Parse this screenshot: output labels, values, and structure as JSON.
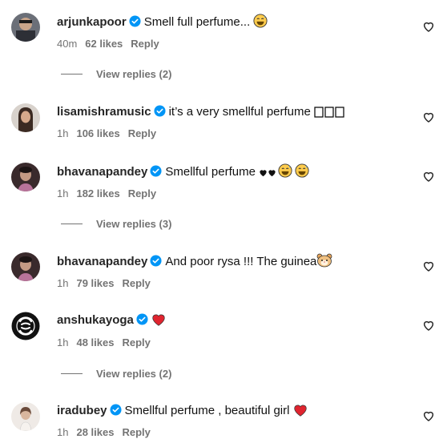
{
  "comments": [
    {
      "username": "arjunkapoor",
      "text": "Smell full perfume... ",
      "emoji": [
        "grin-sweat"
      ],
      "time": "40m",
      "likes": "62 likes",
      "reply": "Reply"
    },
    {
      "username": "lisamishramusic",
      "text": "it’s a very smellful perfume ",
      "emoji": [
        "box",
        "box",
        "box"
      ],
      "time": "1h",
      "likes": "106 likes",
      "reply": "Reply"
    },
    {
      "username": "bhavanapandey",
      "text": "Smellful perfume ",
      "emoji": [
        "black-heart",
        "black-heart",
        "grin-sweat",
        "grin-sweat"
      ],
      "time": "1h",
      "likes": "182 likes",
      "reply": "Reply"
    },
    {
      "username": "bhavanapandey",
      "text": "And poor rysa !!! The guinea",
      "emoji": [
        "hamster"
      ],
      "time": "1h",
      "likes": "79 likes",
      "reply": "Reply"
    },
    {
      "username": "anshukayoga",
      "text": "",
      "emoji": [
        "red-heart"
      ],
      "time": "1h",
      "likes": "48 likes",
      "reply": "Reply"
    },
    {
      "username": "iradubey",
      "text": "Smellful perfume , beautiful girl ",
      "emoji": [
        "red-heart"
      ],
      "time": "1h",
      "likes": "28 likes",
      "reply": "Reply"
    }
  ],
  "view_replies": [
    "View replies (2)",
    "View replies (3)",
    "View replies (2)"
  ],
  "colors": {
    "verified": "#0095f6",
    "muted": "#737373",
    "username": "#262626"
  }
}
